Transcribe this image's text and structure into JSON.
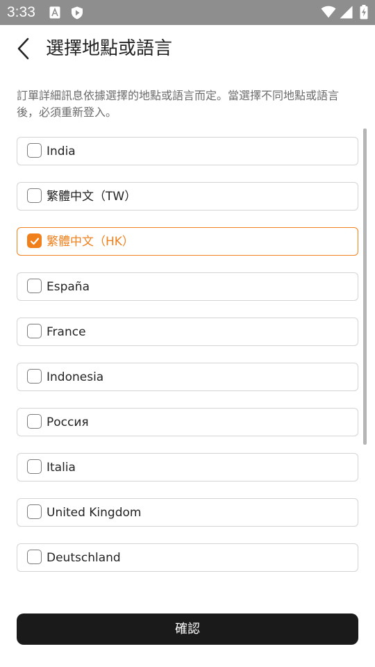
{
  "status_bar": {
    "time": "3:33",
    "icons": [
      "font-icon",
      "shield-icon",
      "wifi-icon",
      "cellular-signal-icon",
      "battery-charging-icon"
    ]
  },
  "header": {
    "back_icon": "chevron-left-icon",
    "title": "選擇地點或語言"
  },
  "description": "訂單詳細訊息依據選擇的地點或語言而定。當選擇不同地點或語言後，必須重新登入。",
  "options": [
    {
      "label": "India",
      "checked": false
    },
    {
      "label": "繁體中文（TW）",
      "checked": false
    },
    {
      "label": "繁體中文（HK）",
      "checked": true
    },
    {
      "label": "España",
      "checked": false
    },
    {
      "label": "France",
      "checked": false
    },
    {
      "label": "Indonesia",
      "checked": false
    },
    {
      "label": "Россия",
      "checked": false
    },
    {
      "label": "Italia",
      "checked": false
    },
    {
      "label": "United Kingdom",
      "checked": false
    },
    {
      "label": "Deutschland",
      "checked": false
    }
  ],
  "confirm_label": "確認",
  "colors": {
    "accent": "#f0801c",
    "button_bg": "#1a1a1a",
    "status_bar_bg": "#8e8e8e"
  }
}
